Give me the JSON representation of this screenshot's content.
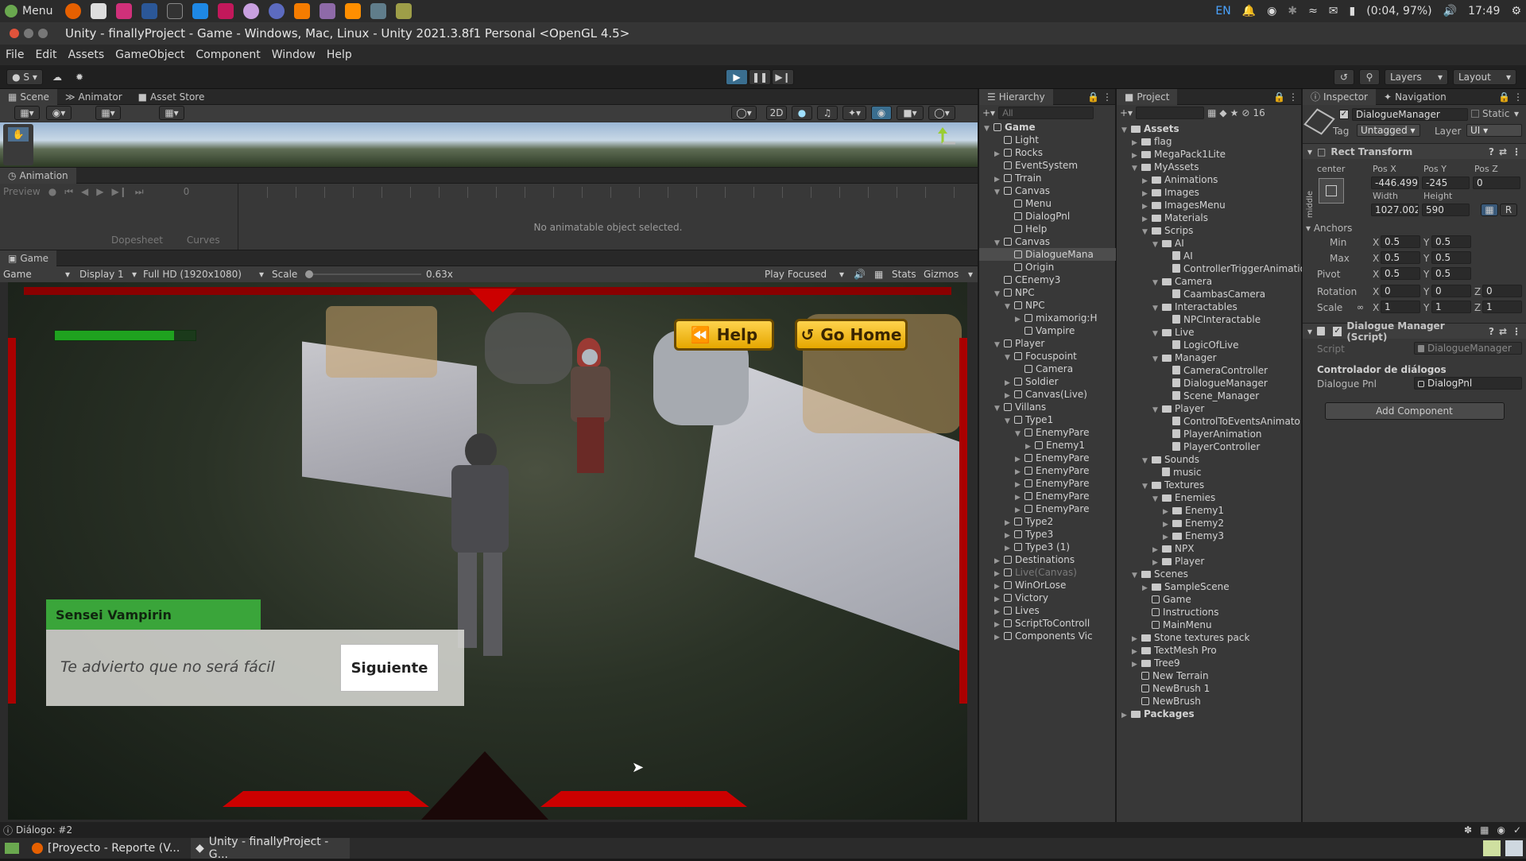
{
  "os": {
    "menu_label": "Menu",
    "keyboard": "EN",
    "battery": "(0:04, 97%)",
    "clock": "17:49"
  },
  "window": {
    "title": "Unity - finallyProject - Game - Windows, Mac, Linux - Unity 2021.3.8f1 Personal <OpenGL 4.5>"
  },
  "menu": [
    "File",
    "Edit",
    "Assets",
    "GameObject",
    "Component",
    "Window",
    "Help"
  ],
  "toolbar": {
    "account": "S",
    "layers": "Layers",
    "layout": "Layout"
  },
  "scene_tabs": [
    "Scene",
    "Animator",
    "Asset Store"
  ],
  "animation": {
    "tab": "Animation",
    "preview": "Preview",
    "frame": "0",
    "message": "No animatable object selected.",
    "dopesheet": "Dopesheet",
    "curves": "Curves"
  },
  "game": {
    "tab": "Game",
    "mode": "Game",
    "display": "Display 1",
    "resolution": "Full HD (1920x1080)",
    "scale_label": "Scale",
    "scale_value": "0.63x",
    "play_focused": "Play Focused",
    "stats": "Stats",
    "gizmos": "Gizmos",
    "help_button": "Help",
    "home_button": "Go Home",
    "speaker": "Sensei Vampirin",
    "dialogue": "Te advierto que no será fácil",
    "next_button": "Siguiente",
    "health_fraction": 0.85
  },
  "hierarchy": {
    "tab": "Hierarchy",
    "search_placeholder": "All",
    "items": [
      {
        "label": "Game",
        "indent": 0,
        "icon": "scene",
        "arrow": "down",
        "bold": true
      },
      {
        "label": "Light",
        "indent": 1,
        "icon": "go"
      },
      {
        "label": "Rocks",
        "indent": 1,
        "icon": "go",
        "arrow": "right"
      },
      {
        "label": "EventSystem",
        "indent": 1,
        "icon": "go"
      },
      {
        "label": "Trrain",
        "indent": 1,
        "icon": "go",
        "arrow": "right"
      },
      {
        "label": "Canvas",
        "indent": 1,
        "icon": "go",
        "arrow": "down"
      },
      {
        "label": "Menu",
        "indent": 2,
        "icon": "go"
      },
      {
        "label": "DialogPnl",
        "indent": 2,
        "icon": "go"
      },
      {
        "label": "Help",
        "indent": 2,
        "icon": "go"
      },
      {
        "label": "Canvas",
        "indent": 1,
        "icon": "go",
        "arrow": "down"
      },
      {
        "label": "DialogueMana",
        "indent": 2,
        "icon": "go",
        "selected": true
      },
      {
        "label": "Origin",
        "indent": 2,
        "icon": "go"
      },
      {
        "label": "CEnemy3",
        "indent": 1,
        "icon": "go"
      },
      {
        "label": "NPC",
        "indent": 1,
        "icon": "go",
        "arrow": "down"
      },
      {
        "label": "NPC",
        "indent": 2,
        "icon": "go",
        "arrow": "down"
      },
      {
        "label": "mixamorig:H",
        "indent": 3,
        "icon": "go",
        "arrow": "right"
      },
      {
        "label": "Vampire",
        "indent": 3,
        "icon": "go"
      },
      {
        "label": "Player",
        "indent": 1,
        "icon": "go",
        "arrow": "down"
      },
      {
        "label": "Focuspoint",
        "indent": 2,
        "icon": "go",
        "arrow": "down"
      },
      {
        "label": "Camera",
        "indent": 3,
        "icon": "go"
      },
      {
        "label": "Soldier",
        "indent": 2,
        "icon": "go",
        "arrow": "right"
      },
      {
        "label": "Canvas(Live)",
        "indent": 2,
        "icon": "go",
        "arrow": "right"
      },
      {
        "label": "Villans",
        "indent": 1,
        "icon": "go",
        "arrow": "down"
      },
      {
        "label": "Type1",
        "indent": 2,
        "icon": "go",
        "arrow": "down"
      },
      {
        "label": "EnemyPare",
        "indent": 3,
        "icon": "go",
        "arrow": "down"
      },
      {
        "label": "Enemy1",
        "indent": 4,
        "icon": "go",
        "arrow": "right"
      },
      {
        "label": "EnemyPare",
        "indent": 3,
        "icon": "go",
        "arrow": "right"
      },
      {
        "label": "EnemyPare",
        "indent": 3,
        "icon": "go",
        "arrow": "right"
      },
      {
        "label": "EnemyPare",
        "indent": 3,
        "icon": "go",
        "arrow": "right"
      },
      {
        "label": "EnemyPare",
        "indent": 3,
        "icon": "go",
        "arrow": "right"
      },
      {
        "label": "EnemyPare",
        "indent": 3,
        "icon": "go",
        "arrow": "right"
      },
      {
        "label": "Type2",
        "indent": 2,
        "icon": "go",
        "arrow": "right"
      },
      {
        "label": "Type3",
        "indent": 2,
        "icon": "go",
        "arrow": "right"
      },
      {
        "label": "Type3 (1)",
        "indent": 2,
        "icon": "go",
        "arrow": "right"
      },
      {
        "label": "Destinations",
        "indent": 1,
        "icon": "go",
        "arrow": "right"
      },
      {
        "label": "Live(Canvas)",
        "indent": 1,
        "icon": "go",
        "arrow": "right",
        "dim": true
      },
      {
        "label": "WinOrLose",
        "indent": 1,
        "icon": "go",
        "arrow": "right"
      },
      {
        "label": "Victory",
        "indent": 1,
        "icon": "go",
        "arrow": "right"
      },
      {
        "label": "Lives",
        "indent": 1,
        "icon": "go",
        "arrow": "right"
      },
      {
        "label": "ScriptToControll",
        "indent": 1,
        "icon": "go",
        "arrow": "right"
      },
      {
        "label": "Components Vic",
        "indent": 1,
        "icon": "go",
        "arrow": "right"
      }
    ]
  },
  "project": {
    "tab": "Project",
    "count": "16",
    "items": [
      {
        "label": "Assets",
        "indent": 0,
        "icon": "folder",
        "arrow": "down",
        "bold": true
      },
      {
        "label": "flag",
        "indent": 1,
        "icon": "folder",
        "arrow": "right"
      },
      {
        "label": "MegaPack1Lite",
        "indent": 1,
        "icon": "folder",
        "arrow": "right"
      },
      {
        "label": "MyAssets",
        "indent": 1,
        "icon": "folder",
        "arrow": "down"
      },
      {
        "label": "Animations",
        "indent": 2,
        "icon": "folder",
        "arrow": "right"
      },
      {
        "label": "Images",
        "indent": 2,
        "icon": "folder",
        "arrow": "right"
      },
      {
        "label": "ImagesMenu",
        "indent": 2,
        "icon": "folder",
        "arrow": "right"
      },
      {
        "label": "Materials",
        "indent": 2,
        "icon": "folder",
        "arrow": "right"
      },
      {
        "label": "Scrips",
        "indent": 2,
        "icon": "folder",
        "arrow": "down"
      },
      {
        "label": "AI",
        "indent": 3,
        "icon": "folder",
        "arrow": "down"
      },
      {
        "label": "AI",
        "indent": 4,
        "icon": "script"
      },
      {
        "label": "ControllerTriggerAnimatio",
        "indent": 4,
        "icon": "script"
      },
      {
        "label": "Camera",
        "indent": 3,
        "icon": "folder",
        "arrow": "down"
      },
      {
        "label": "CaambasCamera",
        "indent": 4,
        "icon": "script"
      },
      {
        "label": "Interactables",
        "indent": 3,
        "icon": "folder",
        "arrow": "down"
      },
      {
        "label": "NPCInteractable",
        "indent": 4,
        "icon": "script"
      },
      {
        "label": "Live",
        "indent": 3,
        "icon": "folder",
        "arrow": "down"
      },
      {
        "label": "LogicOfLive",
        "indent": 4,
        "icon": "script"
      },
      {
        "label": "Manager",
        "indent": 3,
        "icon": "folder",
        "arrow": "down"
      },
      {
        "label": "CameraController",
        "indent": 4,
        "icon": "script"
      },
      {
        "label": "DialogueManager",
        "indent": 4,
        "icon": "script"
      },
      {
        "label": "Scene_Manager",
        "indent": 4,
        "icon": "script"
      },
      {
        "label": "Player",
        "indent": 3,
        "icon": "folder",
        "arrow": "down"
      },
      {
        "label": "ControlToEventsAnimato",
        "indent": 4,
        "icon": "script"
      },
      {
        "label": "PlayerAnimation",
        "indent": 4,
        "icon": "script"
      },
      {
        "label": "PlayerController",
        "indent": 4,
        "icon": "script"
      },
      {
        "label": "Sounds",
        "indent": 2,
        "icon": "folder",
        "arrow": "down"
      },
      {
        "label": "music",
        "indent": 3,
        "icon": "audio"
      },
      {
        "label": "Textures",
        "indent": 2,
        "icon": "folder",
        "arrow": "down"
      },
      {
        "label": "Enemies",
        "indent": 3,
        "icon": "folder",
        "arrow": "down"
      },
      {
        "label": "Enemy1",
        "indent": 4,
        "icon": "folder",
        "arrow": "right"
      },
      {
        "label": "Enemy2",
        "indent": 4,
        "icon": "folder",
        "arrow": "right"
      },
      {
        "label": "Enemy3",
        "indent": 4,
        "icon": "folder",
        "arrow": "right"
      },
      {
        "label": "NPX",
        "indent": 3,
        "icon": "folder",
        "arrow": "right"
      },
      {
        "label": "Player",
        "indent": 3,
        "icon": "folder",
        "arrow": "right"
      },
      {
        "label": "Scenes",
        "indent": 1,
        "icon": "folder",
        "arrow": "down"
      },
      {
        "label": "SampleScene",
        "indent": 2,
        "icon": "folder",
        "arrow": "right"
      },
      {
        "label": "Game",
        "indent": 2,
        "icon": "scene"
      },
      {
        "label": "Instructions",
        "indent": 2,
        "icon": "scene"
      },
      {
        "label": "MainMenu",
        "indent": 2,
        "icon": "scene"
      },
      {
        "label": "Stone textures pack",
        "indent": 1,
        "icon": "folder",
        "arrow": "right"
      },
      {
        "label": "TextMesh Pro",
        "indent": 1,
        "icon": "folder",
        "arrow": "right"
      },
      {
        "label": "Tree9",
        "indent": 1,
        "icon": "folder",
        "arrow": "right"
      },
      {
        "label": "New Terrain",
        "indent": 1,
        "icon": "asset"
      },
      {
        "label": "NewBrush 1",
        "indent": 1,
        "icon": "asset"
      },
      {
        "label": "NewBrush",
        "indent": 1,
        "icon": "asset"
      },
      {
        "label": "Packages",
        "indent": 0,
        "icon": "folder",
        "arrow": "right",
        "bold": true
      }
    ]
  },
  "inspector": {
    "tab": "Inspector",
    "tab2": "Navigation",
    "object_name": "DialogueManager",
    "static_label": "Static",
    "tag_label": "Tag",
    "tag": "Untagged",
    "layer_label": "Layer",
    "layer": "UI",
    "rect": {
      "title": "Rect Transform",
      "anchor_h": "center",
      "anchor_v": "middle",
      "posx_label": "Pos X",
      "posy_label": "Pos Y",
      "posz_label": "Pos Z",
      "posx": "-446.499",
      "posy": "-245",
      "posz": "0",
      "width_label": "Width",
      "height_label": "Height",
      "width": "1027.002",
      "height": "590",
      "anchors": "Anchors",
      "min": "Min",
      "max": "Max",
      "pivot": "Pivot",
      "x": "X",
      "y": "Y",
      "z": "Z",
      "half": "0.5",
      "rotation": "Rotation",
      "scale": "Scale",
      "zero": "0",
      "one": "1",
      "r": "R"
    },
    "script": {
      "title": "Dialogue Manager (Script)",
      "script_label": "Script",
      "script_value": "DialogueManager",
      "section": "Controlador de diálogos",
      "field_label": "Dialogue Pnl",
      "field_value": "DialogPnl"
    },
    "add_component": "Add Component"
  },
  "status": {
    "message": "Diálogo: #2"
  },
  "taskbar": [
    {
      "label": "[Proyecto - Reporte (V..."
    },
    {
      "label": "Unity - finallyProject - G..."
    }
  ]
}
